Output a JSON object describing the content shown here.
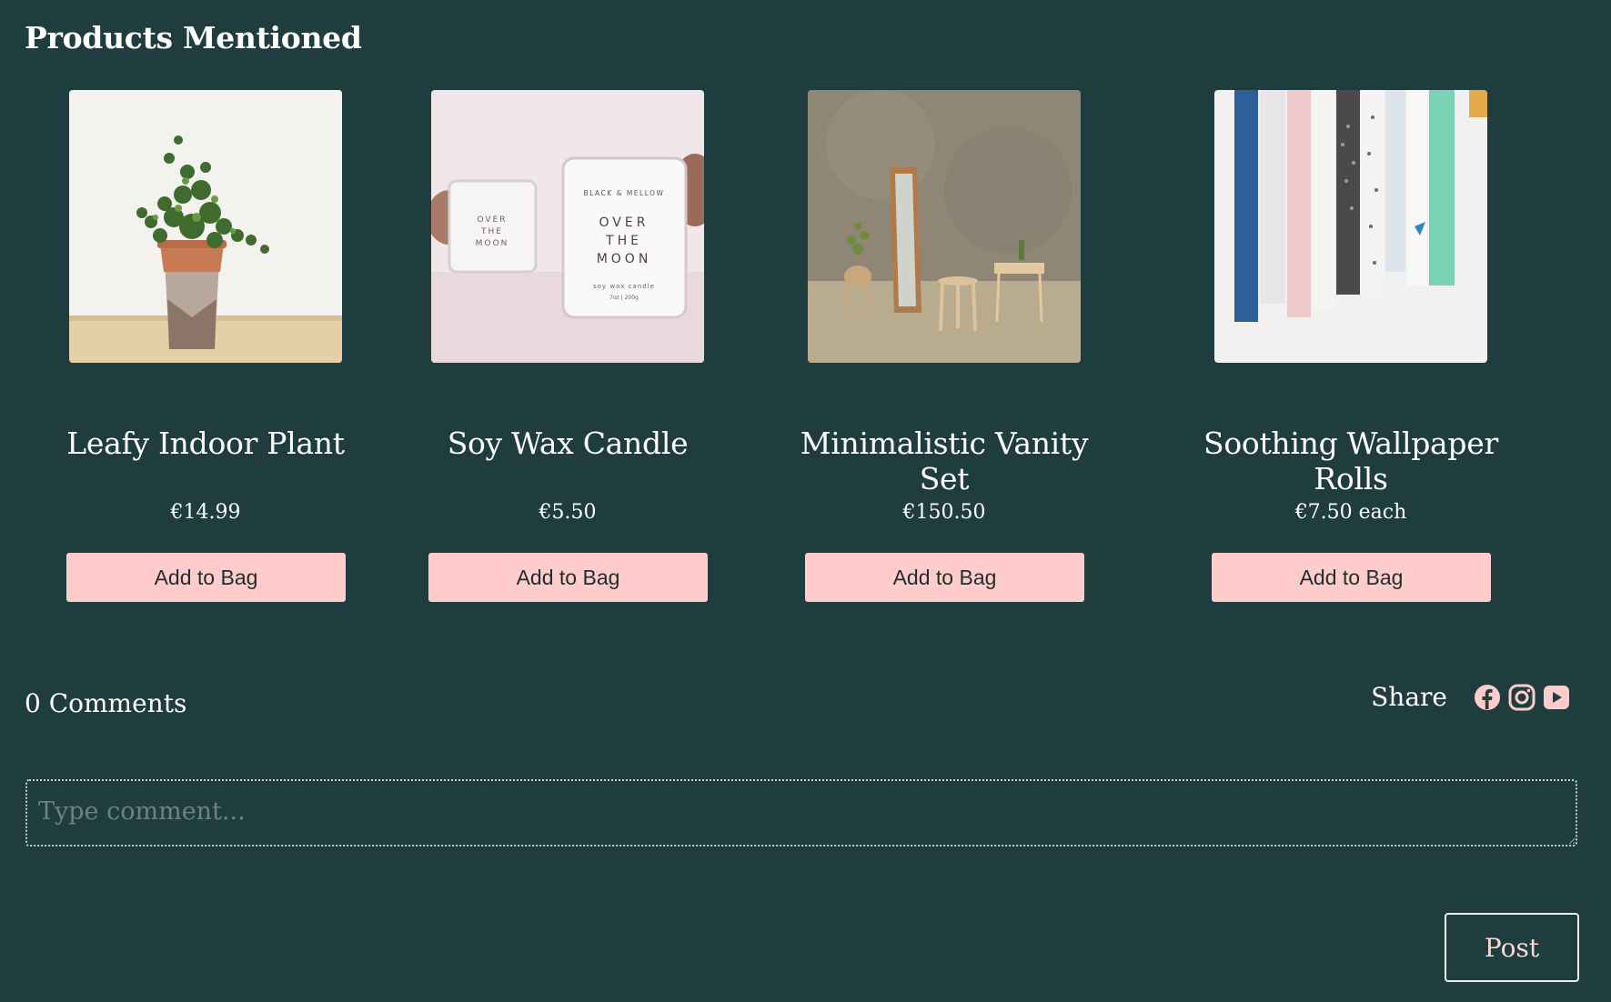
{
  "section_title": "Products Mentioned",
  "products": [
    {
      "name": "Leafy Indoor Plant",
      "price": "€14.99",
      "button": "Add to Bag"
    },
    {
      "name": "Soy Wax Candle",
      "price": "€5.50",
      "button": "Add to Bag",
      "candle_text": {
        "brand": "BLACK & MELLOW",
        "line1": "OVER",
        "line2": "THE",
        "line3": "MOON",
        "subtitle": "soy wax candle",
        "weight": "7oz | 200g"
      }
    },
    {
      "name": "Minimalistic Vanity Set",
      "price": "€150.50",
      "button": "Add to Bag"
    },
    {
      "name": "Soothing Wallpaper Rolls",
      "price": "€7.50 each",
      "button": "Add to Bag"
    }
  ],
  "comments": {
    "count_label": "0 Comments",
    "placeholder": "Type comment...",
    "post_label": "Post"
  },
  "share": {
    "label": "Share",
    "icons": [
      "facebook-icon",
      "instagram-icon",
      "youtube-icon"
    ],
    "icon_color": "#ffcccc"
  },
  "colors": {
    "background": "#1f3d3f",
    "button_bg": "#ffcccc",
    "text": "#ffffff"
  }
}
